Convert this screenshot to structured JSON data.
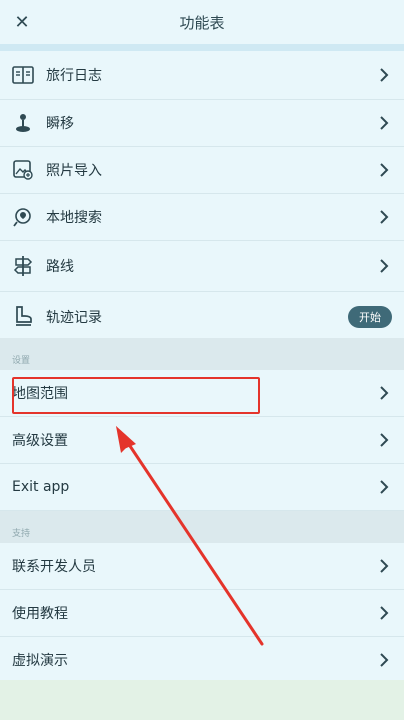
{
  "header": {
    "title": "功能表"
  },
  "tools": [
    {
      "label": "旅行日志",
      "icon": "journal-icon"
    },
    {
      "label": "瞬移",
      "icon": "joystick-icon"
    },
    {
      "label": "照片导入",
      "icon": "photo-import-icon"
    },
    {
      "label": "本地搜索",
      "icon": "search-location-icon"
    },
    {
      "label": "路线",
      "icon": "signpost-icon"
    },
    {
      "label": "轨迹记录",
      "icon": "boot-icon",
      "button": "开始"
    }
  ],
  "settings": {
    "header": "设置",
    "items": [
      {
        "label": "地图范围"
      },
      {
        "label": "高级设置"
      },
      {
        "label": "Exit app"
      }
    ]
  },
  "support": {
    "header": "支持",
    "items": [
      {
        "label": "联系开发人员"
      },
      {
        "label": "使用教程"
      },
      {
        "label": "虚拟演示"
      }
    ]
  },
  "colors": {
    "accent": "#3f6a78",
    "row_bg": "#e9f7fb",
    "section_bg": "#dbe9ed",
    "annotation": "#e4342b"
  }
}
